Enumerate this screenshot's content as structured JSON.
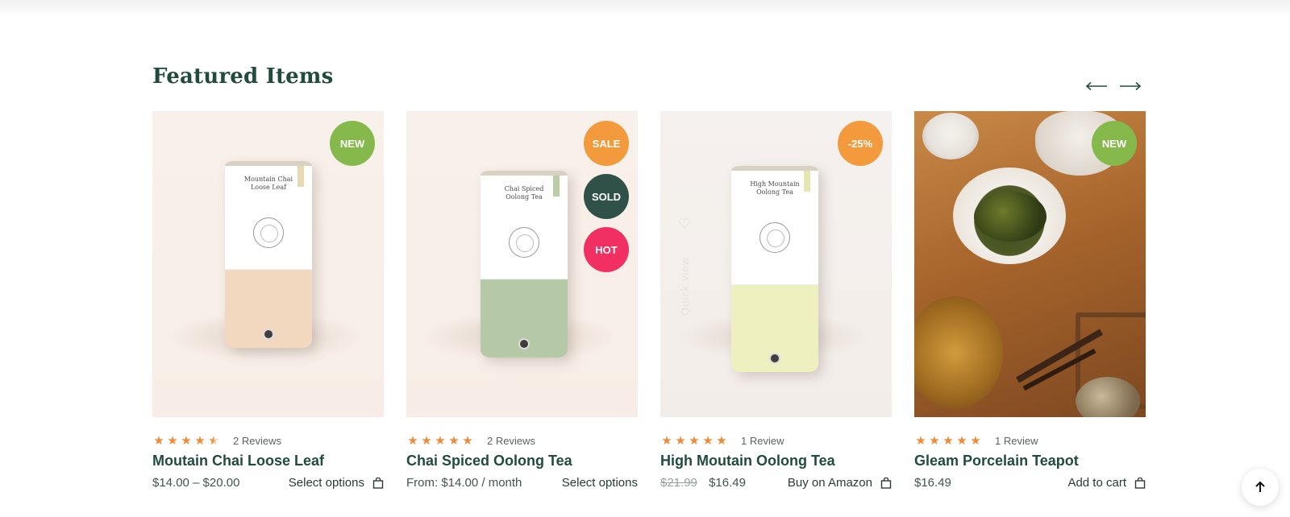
{
  "section": {
    "title": "Featured Items"
  },
  "colors": {
    "accent_green": "#224b40",
    "badge_new": "#86b94b",
    "badge_sale": "#f39a3c",
    "badge_sold": "#2f5148",
    "badge_hot": "#f12f63",
    "star": "#f08a34"
  },
  "navigation": {
    "prev_icon": "arrow-left-icon",
    "next_icon": "arrow-right-icon"
  },
  "products": [
    {
      "badges": [
        "NEW"
      ],
      "can_label": "Mountain Chai\nLoose Leaf",
      "rating": 4.5,
      "reviews": "2 Reviews",
      "name": "Moutain Chai Loose Leaf",
      "price": "$14.00 – $20.00",
      "action": "Select options"
    },
    {
      "badges": [
        "SALE",
        "SOLD",
        "HOT"
      ],
      "can_label": "Chai Spiced\nOolong Tea",
      "rating": 5,
      "reviews": "2 Reviews",
      "name": "Chai Spiced Oolong Tea",
      "price": "From: $14.00 / month",
      "action": "Select options"
    },
    {
      "badges": [
        "-25%"
      ],
      "can_label": "High Mountain\nOolong Tea",
      "quick_view": "Quick view",
      "rating": 5,
      "reviews": "1 Review",
      "name": "High Moutain Oolong Tea",
      "price_old": "$21.99",
      "price": "$16.49",
      "action": "Buy on Amazon"
    },
    {
      "badges": [
        "NEW"
      ],
      "rating": 5,
      "reviews": "1 Review",
      "name": "Gleam Porcelain Teapot",
      "price": "$16.49",
      "action": "Add to cart"
    }
  ],
  "back_to_top": {
    "icon": "arrow-up-icon"
  }
}
